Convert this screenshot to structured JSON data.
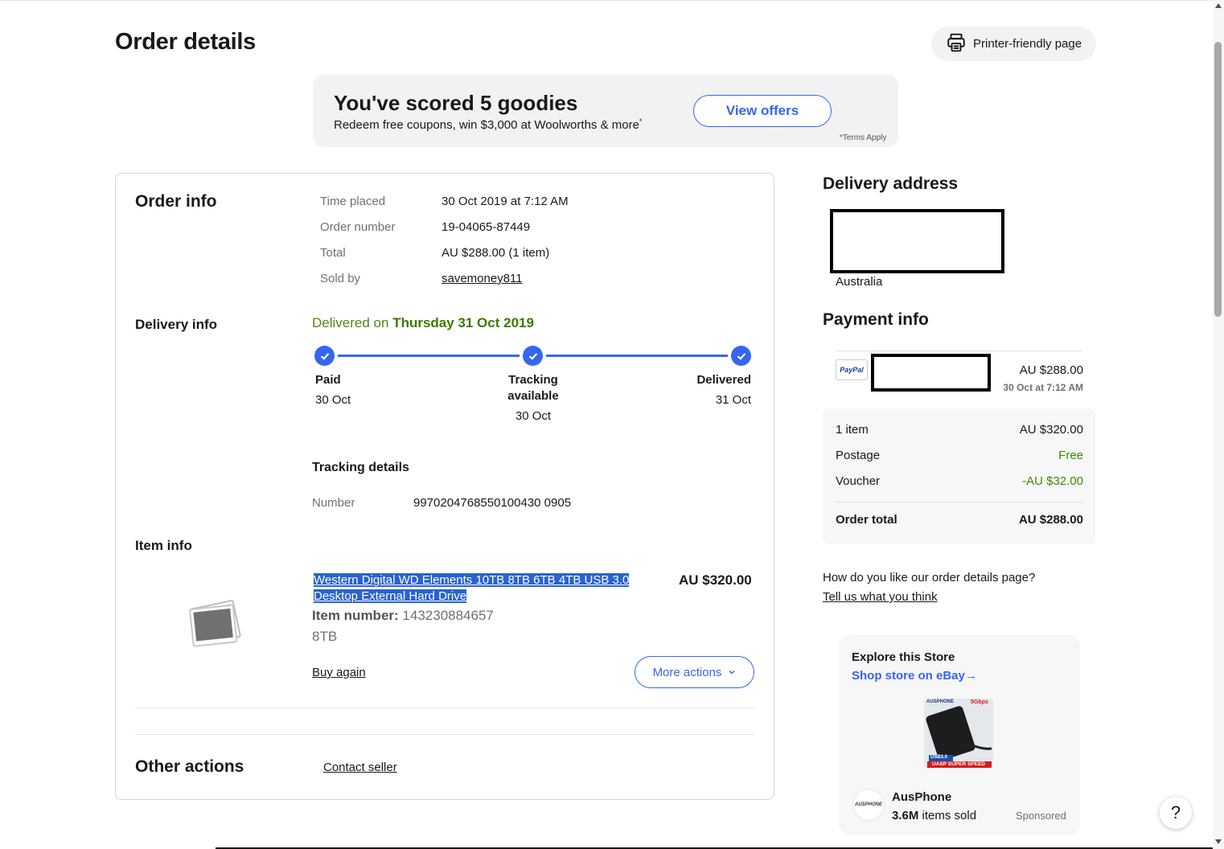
{
  "page": {
    "title": "Order details",
    "printer_label": "Printer-friendly page"
  },
  "promo": {
    "title": "You've scored 5 goodies",
    "subtitle": "Redeem free coupons, win $3,000 at Woolworths & more",
    "subtitle_mark": "*",
    "button": "View offers",
    "terms": "*Terms Apply"
  },
  "order_info": {
    "heading": "Order info",
    "rows": [
      {
        "label": "Time placed",
        "value": "30 Oct 2019 at 7:12 AM"
      },
      {
        "label": "Order number",
        "value": "19-04065-87449"
      },
      {
        "label": "Total",
        "value": "AU $288.00 (1 item)"
      },
      {
        "label": "Sold by",
        "value": "savemoney811"
      }
    ]
  },
  "delivery_info": {
    "heading": "Delivery info",
    "delivered_prefix": "Delivered on",
    "delivered_date": "Thursday 31 Oct 2019",
    "steps": [
      {
        "label": "Paid",
        "date": "30 Oct"
      },
      {
        "label": "Tracking available",
        "label_line1": "Tracking",
        "label_line2": "available",
        "date": "30 Oct"
      },
      {
        "label": "Delivered",
        "date": "31 Oct"
      }
    ],
    "tracking_heading": "Tracking details",
    "tracking_label": "Number",
    "tracking_number": "9970204768550100430 0905"
  },
  "item_info": {
    "heading": "Item info",
    "title": "Western Digital WD Elements 10TB 8TB 6TB 4TB USB 3.0 Desktop External Hard Drive",
    "price": "AU $320.00",
    "item_number_label": "Item number:",
    "item_number": "143230884657",
    "variant": "8TB",
    "buy_again": "Buy again",
    "more_actions": "More actions"
  },
  "other_actions": {
    "heading": "Other actions",
    "contact_seller": "Contact seller"
  },
  "delivery_address": {
    "heading": "Delivery address",
    "country": "Australia"
  },
  "payment_info": {
    "heading": "Payment info",
    "method_logo": "PayPal",
    "amount": "AU $288.00",
    "date": "30 Oct at 7:12 AM",
    "summary": [
      {
        "label": "1 item",
        "value": "AU $320.00"
      },
      {
        "label": "Postage",
        "value": "Free"
      },
      {
        "label": "Voucher",
        "value": "-AU $32.00"
      }
    ],
    "total_label": "Order total",
    "total_value": "AU $288.00"
  },
  "feedback": {
    "question": "How do you like our order details page?",
    "link": "Tell us what you think"
  },
  "store_ad": {
    "heading": "Explore this Store",
    "link": "Shop store on eBay",
    "link_arrow": "→",
    "store_name": "AusPhone",
    "sold_count": "3.6M",
    "sold_suffix": "items sold",
    "sponsored": "Sponsored",
    "logo_text": "AUSPHONE",
    "product_badge_top": "AUSPHONE",
    "product_badge_speed": "5Gbps",
    "product_badge_usb": "USB3.0",
    "product_badge_bottom": "UASP SUPER SPEED"
  },
  "help_label": "?",
  "colors": {
    "accent": "#3665f3",
    "delivered_green": "#3d7a00",
    "text": "#191919",
    "muted": "#707070"
  },
  "icons": {
    "printer": "printer-icon",
    "check": "check-icon",
    "chevron": "chevron-down-icon",
    "item_image": "image-placeholder-icon"
  }
}
